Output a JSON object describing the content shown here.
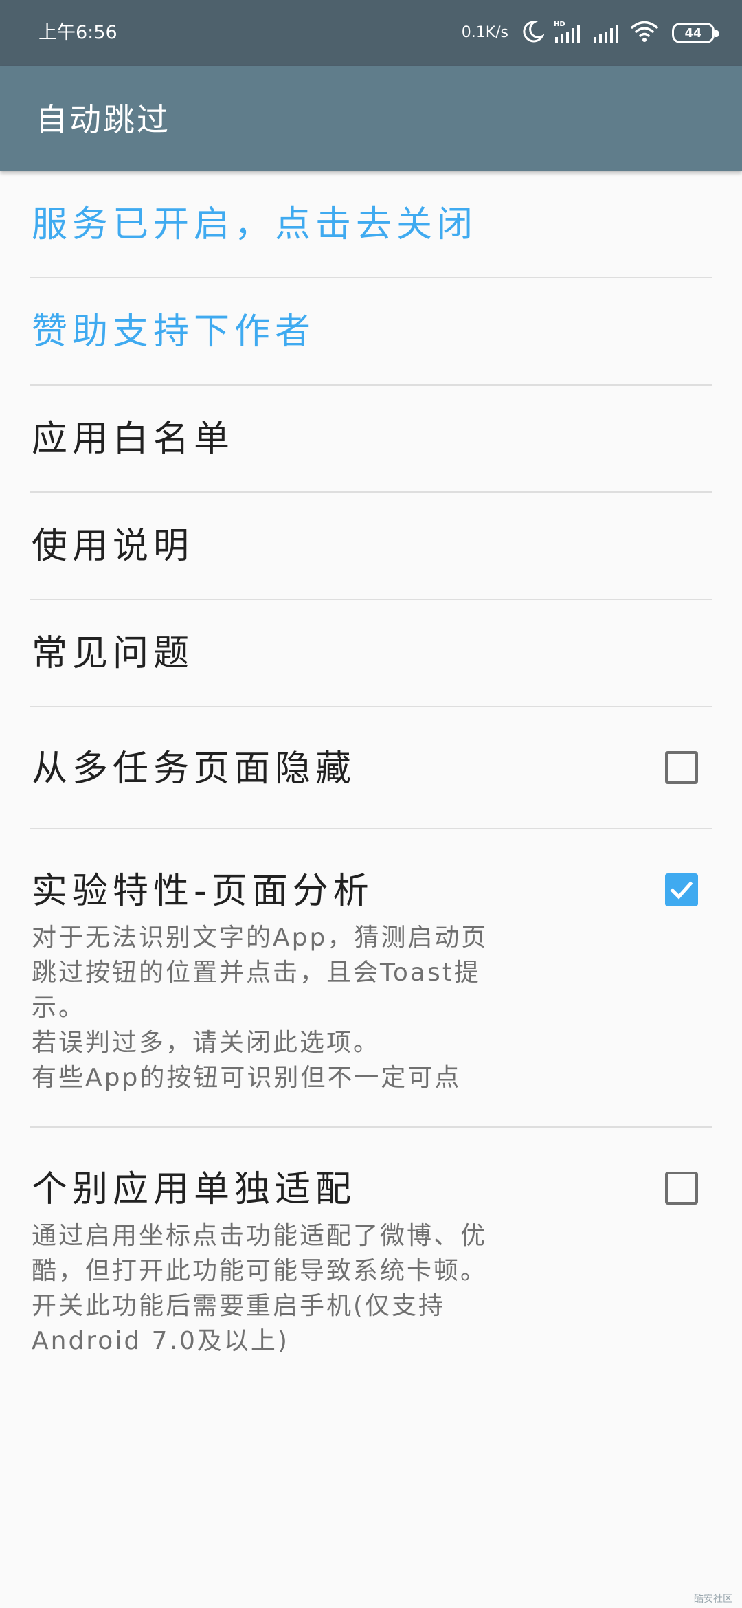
{
  "status_bar": {
    "time": "上午6:56",
    "net_speed": "0.1K/s",
    "battery_level": "44",
    "icons": [
      "moon-icon",
      "hd-signal-icon",
      "signal-icon",
      "wifi-icon",
      "battery-icon"
    ]
  },
  "app_bar": {
    "title": "自动跳过",
    "background_color": "#607d8b"
  },
  "preferences": {
    "service_toggle": "服务已开启，点击去关闭",
    "donate": "赞助支持下作者",
    "whitelist": "应用白名单",
    "instructions": "使用说明",
    "faq": "常见问题",
    "hide_recents": {
      "title": "从多任务页面隐藏",
      "checked": false
    },
    "page_analysis": {
      "title": "实验特性-页面分析",
      "summary": "对于无法识别文字的App，猜测启动页\n跳过按钮的位置并点击，且会Toast提\n示。\n若误判过多，请关闭此选项。\n有些App的按钮可识别但不一定可点",
      "checked": true
    },
    "per_app_adapt": {
      "title": "个别应用单独适配",
      "summary": "通过启用坐标点击功能适配了微博、优\n酷，但打开此功能可能导致系统卡顿。\n开关此功能后需要重启手机(仅支持\nAndroid 7.0及以上)",
      "checked": false
    }
  },
  "colors": {
    "accent": "#3faaf0",
    "status_bar": "#4e616c"
  },
  "watermark": "酷安社区"
}
